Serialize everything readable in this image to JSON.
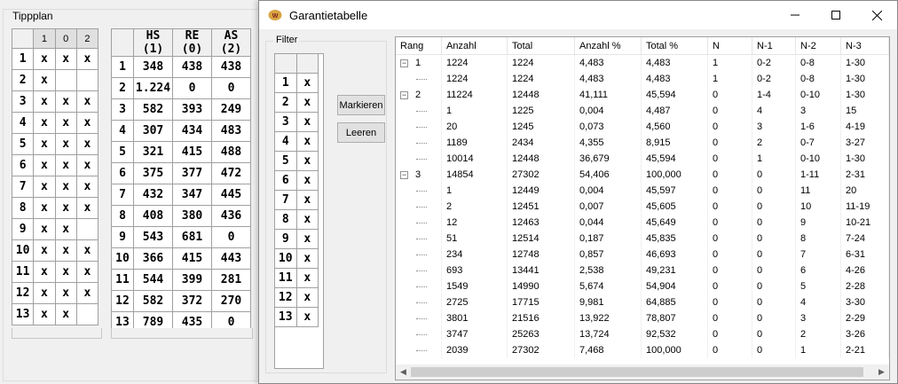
{
  "tippplan": {
    "title": "Tippplan",
    "tipp_header": [
      "1",
      "0",
      "2"
    ],
    "tipp_rows": [
      {
        "n": "1",
        "c": [
          "x",
          "x",
          "x"
        ]
      },
      {
        "n": "2",
        "c": [
          "x",
          "",
          ""
        ]
      },
      {
        "n": "3",
        "c": [
          "x",
          "x",
          "x"
        ]
      },
      {
        "n": "4",
        "c": [
          "x",
          "x",
          "x"
        ]
      },
      {
        "n": "5",
        "c": [
          "x",
          "x",
          "x"
        ]
      },
      {
        "n": "6",
        "c": [
          "x",
          "x",
          "x"
        ]
      },
      {
        "n": "7",
        "c": [
          "x",
          "x",
          "x"
        ]
      },
      {
        "n": "8",
        "c": [
          "x",
          "x",
          "x"
        ]
      },
      {
        "n": "9",
        "c": [
          "x",
          "x",
          ""
        ]
      },
      {
        "n": "10",
        "c": [
          "x",
          "x",
          "x"
        ]
      },
      {
        "n": "11",
        "c": [
          "x",
          "x",
          "x"
        ]
      },
      {
        "n": "12",
        "c": [
          "x",
          "x",
          "x"
        ]
      },
      {
        "n": "13",
        "c": [
          "x",
          "x",
          ""
        ]
      }
    ],
    "stats_header": [
      "HS (1)",
      "RE (0)",
      "AS (2)"
    ],
    "stats_rows": [
      {
        "n": "1",
        "c": [
          "348",
          "438",
          "438"
        ]
      },
      {
        "n": "2",
        "c": [
          "1.224",
          "0",
          "0"
        ]
      },
      {
        "n": "3",
        "c": [
          "582",
          "393",
          "249"
        ]
      },
      {
        "n": "4",
        "c": [
          "307",
          "434",
          "483"
        ]
      },
      {
        "n": "5",
        "c": [
          "321",
          "415",
          "488"
        ]
      },
      {
        "n": "6",
        "c": [
          "375",
          "377",
          "472"
        ]
      },
      {
        "n": "7",
        "c": [
          "432",
          "347",
          "445"
        ]
      },
      {
        "n": "8",
        "c": [
          "408",
          "380",
          "436"
        ]
      },
      {
        "n": "9",
        "c": [
          "543",
          "681",
          "0"
        ]
      },
      {
        "n": "10",
        "c": [
          "366",
          "415",
          "443"
        ]
      },
      {
        "n": "11",
        "c": [
          "544",
          "399",
          "281"
        ]
      },
      {
        "n": "12",
        "c": [
          "582",
          "372",
          "270"
        ]
      },
      {
        "n": "13",
        "c": [
          "789",
          "435",
          "0"
        ]
      }
    ]
  },
  "garantie": {
    "title": "Garantietabelle",
    "filter_label": "Filter",
    "filter_rows": [
      {
        "n": "1",
        "v": "x"
      },
      {
        "n": "2",
        "v": "x"
      },
      {
        "n": "3",
        "v": "x"
      },
      {
        "n": "4",
        "v": "x"
      },
      {
        "n": "5",
        "v": "x"
      },
      {
        "n": "6",
        "v": "x"
      },
      {
        "n": "7",
        "v": "x"
      },
      {
        "n": "8",
        "v": "x"
      },
      {
        "n": "9",
        "v": "x"
      },
      {
        "n": "10",
        "v": "x"
      },
      {
        "n": "11",
        "v": "x"
      },
      {
        "n": "12",
        "v": "x"
      },
      {
        "n": "13",
        "v": "x"
      }
    ],
    "mark_button": "Markieren",
    "clear_button": "Leeren",
    "columns": [
      "Rang",
      "Anzahl",
      "Total",
      "Anzahl %",
      "Total %",
      "N",
      "N-1",
      "N-2",
      "N-3"
    ],
    "rows": [
      {
        "level": 0,
        "rang": "1",
        "expander": "−",
        "c": [
          "1224",
          "1224",
          "4,483",
          "4,483",
          "1",
          "0-2",
          "0-8",
          "1-30"
        ]
      },
      {
        "level": 1,
        "rang": "",
        "c": [
          "1224",
          "1224",
          "4,483",
          "4,483",
          "1",
          "0-2",
          "0-8",
          "1-30"
        ]
      },
      {
        "level": 0,
        "rang": "2",
        "expander": "−",
        "c": [
          "11224",
          "12448",
          "41,111",
          "45,594",
          "0",
          "1-4",
          "0-10",
          "1-30"
        ]
      },
      {
        "level": 1,
        "rang": "",
        "c": [
          "1",
          "1225",
          "0,004",
          "4,487",
          "0",
          "4",
          "3",
          "15"
        ]
      },
      {
        "level": 1,
        "rang": "",
        "c": [
          "20",
          "1245",
          "0,073",
          "4,560",
          "0",
          "3",
          "1-6",
          "4-19"
        ]
      },
      {
        "level": 1,
        "rang": "",
        "c": [
          "1189",
          "2434",
          "4,355",
          "8,915",
          "0",
          "2",
          "0-7",
          "3-27"
        ]
      },
      {
        "level": 1,
        "rang": "",
        "c": [
          "10014",
          "12448",
          "36,679",
          "45,594",
          "0",
          "1",
          "0-10",
          "1-30"
        ]
      },
      {
        "level": 0,
        "rang": "3",
        "expander": "−",
        "c": [
          "14854",
          "27302",
          "54,406",
          "100,000",
          "0",
          "0",
          "1-11",
          "2-31"
        ]
      },
      {
        "level": 1,
        "rang": "",
        "c": [
          "1",
          "12449",
          "0,004",
          "45,597",
          "0",
          "0",
          "11",
          "20"
        ]
      },
      {
        "level": 1,
        "rang": "",
        "c": [
          "2",
          "12451",
          "0,007",
          "45,605",
          "0",
          "0",
          "10",
          "11-19"
        ]
      },
      {
        "level": 1,
        "rang": "",
        "c": [
          "12",
          "12463",
          "0,044",
          "45,649",
          "0",
          "0",
          "9",
          "10-21"
        ]
      },
      {
        "level": 1,
        "rang": "",
        "c": [
          "51",
          "12514",
          "0,187",
          "45,835",
          "0",
          "0",
          "8",
          "7-24"
        ]
      },
      {
        "level": 1,
        "rang": "",
        "c": [
          "234",
          "12748",
          "0,857",
          "46,693",
          "0",
          "0",
          "7",
          "6-31"
        ]
      },
      {
        "level": 1,
        "rang": "",
        "c": [
          "693",
          "13441",
          "2,538",
          "49,231",
          "0",
          "0",
          "6",
          "4-26"
        ]
      },
      {
        "level": 1,
        "rang": "",
        "c": [
          "1549",
          "14990",
          "5,674",
          "54,904",
          "0",
          "0",
          "5",
          "2-28"
        ]
      },
      {
        "level": 1,
        "rang": "",
        "c": [
          "2725",
          "17715",
          "9,981",
          "64,885",
          "0",
          "0",
          "4",
          "3-30"
        ]
      },
      {
        "level": 1,
        "rang": "",
        "c": [
          "3801",
          "21516",
          "13,922",
          "78,807",
          "0",
          "0",
          "3",
          "2-29"
        ]
      },
      {
        "level": 1,
        "rang": "",
        "c": [
          "3747",
          "25263",
          "13,724",
          "92,532",
          "0",
          "0",
          "2",
          "3-26"
        ]
      },
      {
        "level": 1,
        "rang": "",
        "c": [
          "2039",
          "27302",
          "7,468",
          "100,000",
          "0",
          "0",
          "1",
          "2-21"
        ]
      }
    ]
  },
  "icons": {
    "app": "app-icon",
    "minimize": "minimize-icon",
    "maximize": "maximize-icon",
    "close": "close-icon"
  }
}
